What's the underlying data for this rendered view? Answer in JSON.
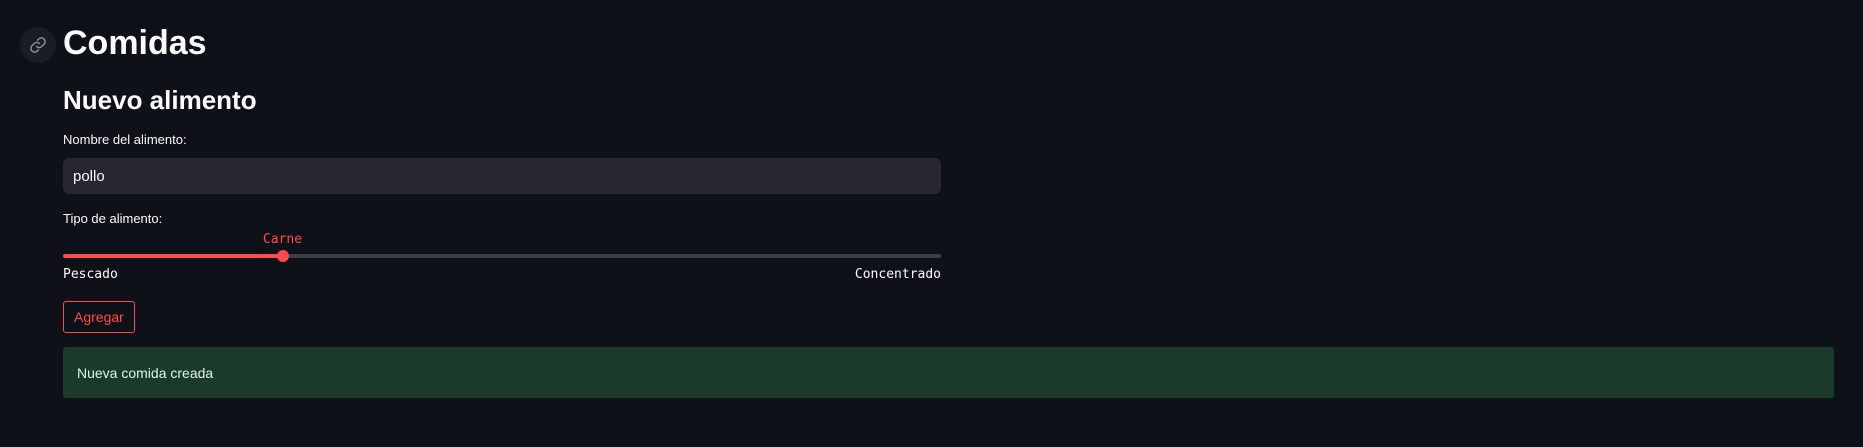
{
  "page": {
    "title": "Comidas",
    "anchor_icon": "link-icon"
  },
  "form": {
    "heading": "Nuevo alimento",
    "name_label": "Nombre del alimento:",
    "name_value": "pollo",
    "type_label": "Tipo de alimento:",
    "slider": {
      "options": [
        "Pescado",
        "Carne",
        "Concentrado"
      ],
      "selected": "Carne",
      "selected_fraction": 0.25,
      "min_label": "Pescado",
      "max_label": "Concentrado"
    },
    "submit_label": "Agregar"
  },
  "alert": {
    "message": "Nueva comida creada"
  },
  "colors": {
    "background": "#0e1117",
    "accent": "#ff4b4b",
    "input_bg": "#262730",
    "success_bg": "#1b3b2a"
  }
}
